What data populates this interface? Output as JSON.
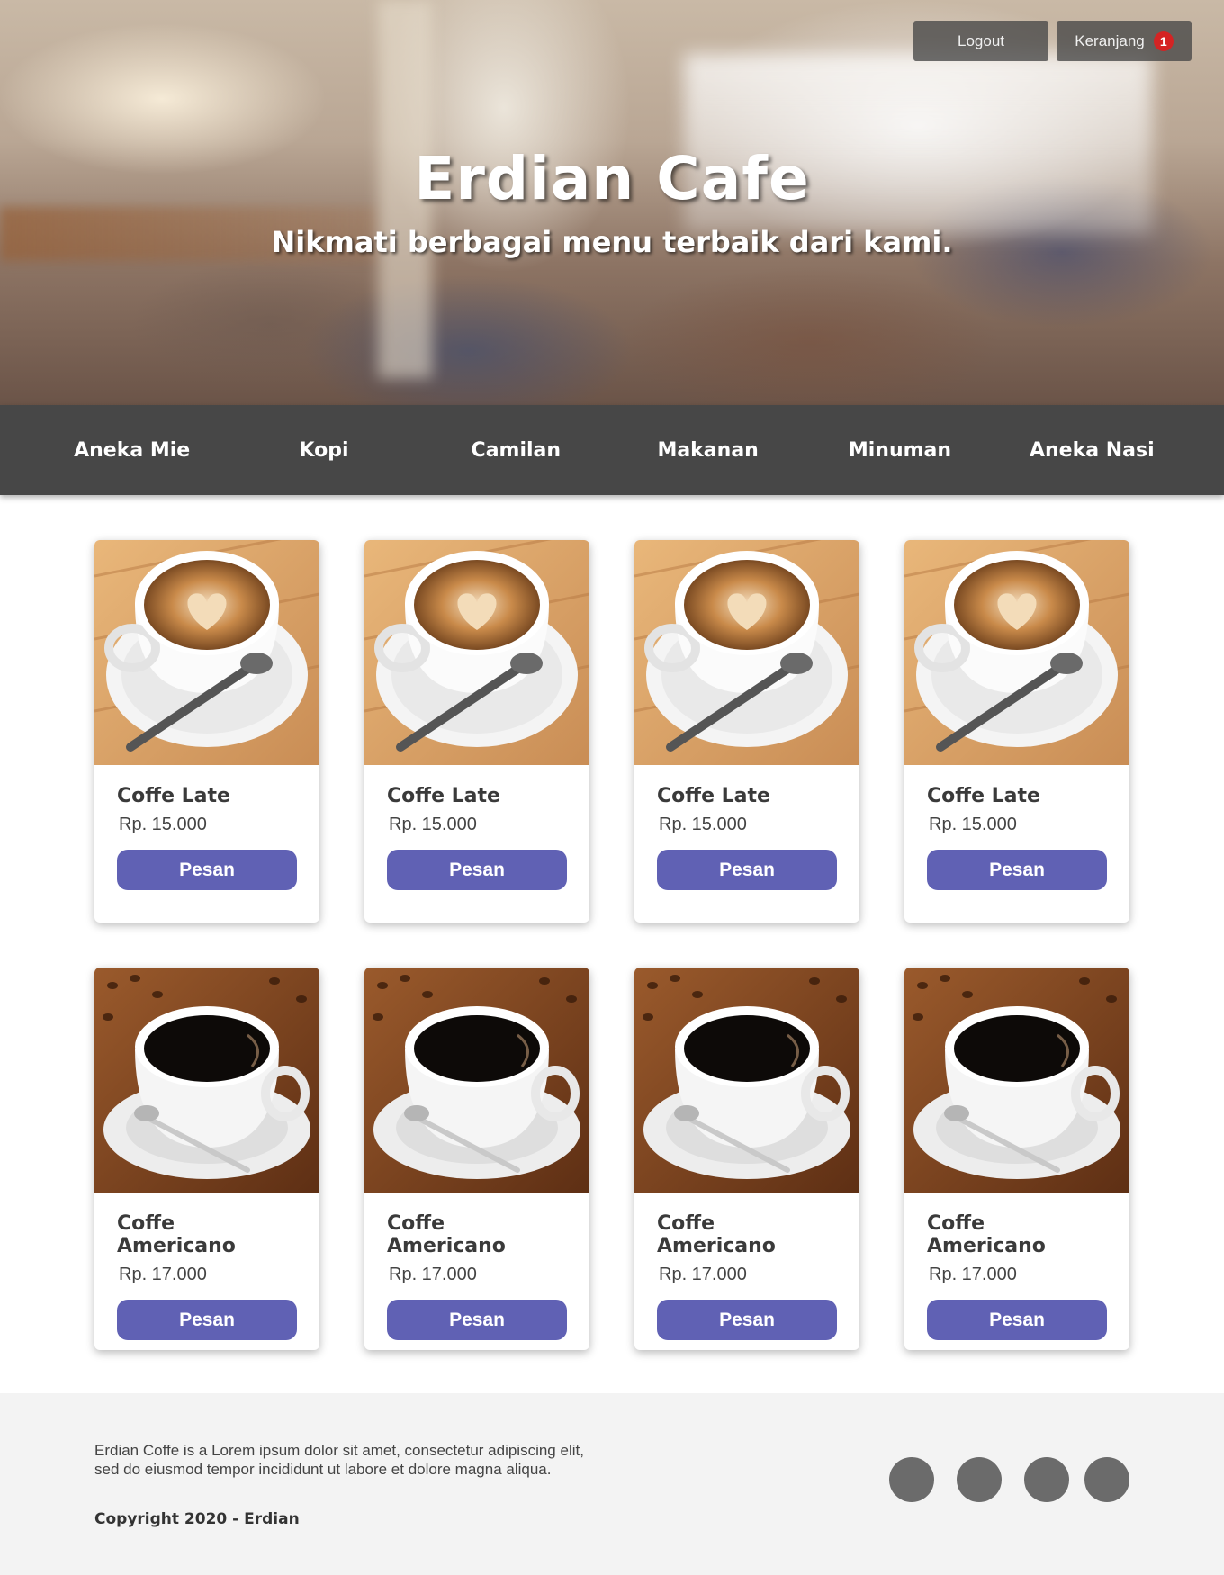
{
  "header": {
    "logout_label": "Logout",
    "cart_label": "Keranjang",
    "cart_count": "1",
    "title": "Erdian Cafe",
    "subtitle": "Nikmati berbagai menu terbaik dari kami."
  },
  "nav": {
    "items": [
      {
        "label": "Aneka Mie"
      },
      {
        "label": "Kopi"
      },
      {
        "label": "Camilan"
      },
      {
        "label": "Makanan"
      },
      {
        "label": "Minuman"
      },
      {
        "label": "Aneka Nasi"
      }
    ]
  },
  "products": [
    {
      "name": "Coffe Late",
      "price": "Rp. 15.000",
      "button": "Pesan",
      "image": "latte-image"
    },
    {
      "name": "Coffe Late",
      "price": "Rp. 15.000",
      "button": "Pesan",
      "image": "latte-image"
    },
    {
      "name": "Coffe Late",
      "price": "Rp. 15.000",
      "button": "Pesan",
      "image": "latte-image"
    },
    {
      "name": "Coffe Late",
      "price": "Rp. 15.000",
      "button": "Pesan",
      "image": "latte-image"
    },
    {
      "name": "Coffe Americano",
      "price": "Rp. 17.000",
      "button": "Pesan",
      "image": "americano-image"
    },
    {
      "name": "Coffe Americano",
      "price": "Rp. 17.000",
      "button": "Pesan",
      "image": "americano-image"
    },
    {
      "name": "Coffe Americano",
      "price": "Rp. 17.000",
      "button": "Pesan",
      "image": "americano-image"
    },
    {
      "name": "Coffe Americano",
      "price": "Rp. 17.000",
      "button": "Pesan",
      "image": "americano-image"
    }
  ],
  "footer": {
    "description": "Erdian Coffe is a Lorem ipsum dolor sit amet, consectetur adipiscing elit, sed do eiusmod tempor incididunt ut labore et dolore magna aliqua.",
    "copyright": "Copyright 2020 - Erdian",
    "socials": [
      "social-icon",
      "social-icon",
      "social-icon",
      "social-icon"
    ]
  },
  "colors": {
    "accent": "#6061b4",
    "nav_bg": "#474747",
    "badge": "#d42323",
    "footer_bg": "#f3f3f3"
  }
}
